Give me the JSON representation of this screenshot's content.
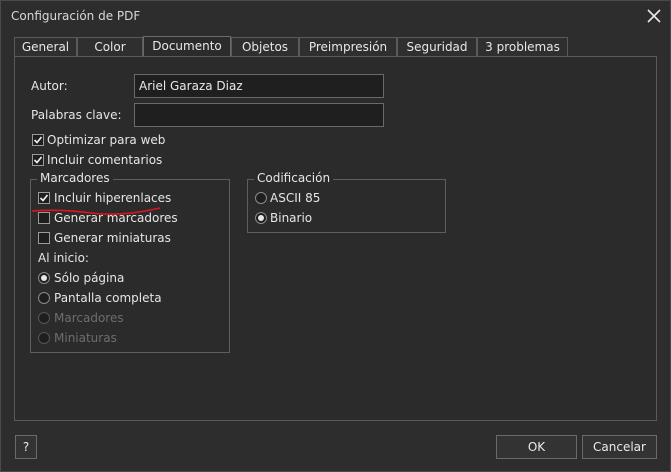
{
  "window": {
    "title": "Configuración de PDF"
  },
  "tabs": [
    {
      "label": "General"
    },
    {
      "label": "Color"
    },
    {
      "label": "Documento"
    },
    {
      "label": "Objetos"
    },
    {
      "label": "Preimpresión"
    },
    {
      "label": "Seguridad"
    },
    {
      "label": "3 problemas"
    }
  ],
  "fields": {
    "author_label": "Autor:",
    "author_value": "Ariel Garaza Diaz",
    "keywords_label": "Palabras clave:",
    "keywords_value": ""
  },
  "options": {
    "optimize_web": {
      "label": "Optimizar para web",
      "checked": true
    },
    "include_comments": {
      "label": "Incluir comentarios",
      "checked": true
    }
  },
  "bookmarks": {
    "legend": "Marcadores",
    "include_hyperlinks": {
      "label": "Incluir hiperenlaces",
      "checked": true
    },
    "generate_bookmarks": {
      "label": "Generar marcadores",
      "checked": false
    },
    "generate_thumbnails": {
      "label": "Generar miniaturas",
      "checked": false
    },
    "on_start_label": "Al inicio:",
    "radios": [
      {
        "label": "Sólo página",
        "selected": true,
        "enabled": true
      },
      {
        "label": "Pantalla completa",
        "selected": false,
        "enabled": true
      },
      {
        "label": "Marcadores",
        "selected": false,
        "enabled": false
      },
      {
        "label": "Miniaturas",
        "selected": false,
        "enabled": false
      }
    ]
  },
  "encoding": {
    "legend": "Codificación",
    "radios": [
      {
        "label": "ASCII 85",
        "selected": false
      },
      {
        "label": "Binario",
        "selected": true
      }
    ]
  },
  "buttons": {
    "help": "?",
    "ok": "OK",
    "cancel": "Cancelar"
  },
  "colors": {
    "annotation_red": "#e0141e"
  }
}
